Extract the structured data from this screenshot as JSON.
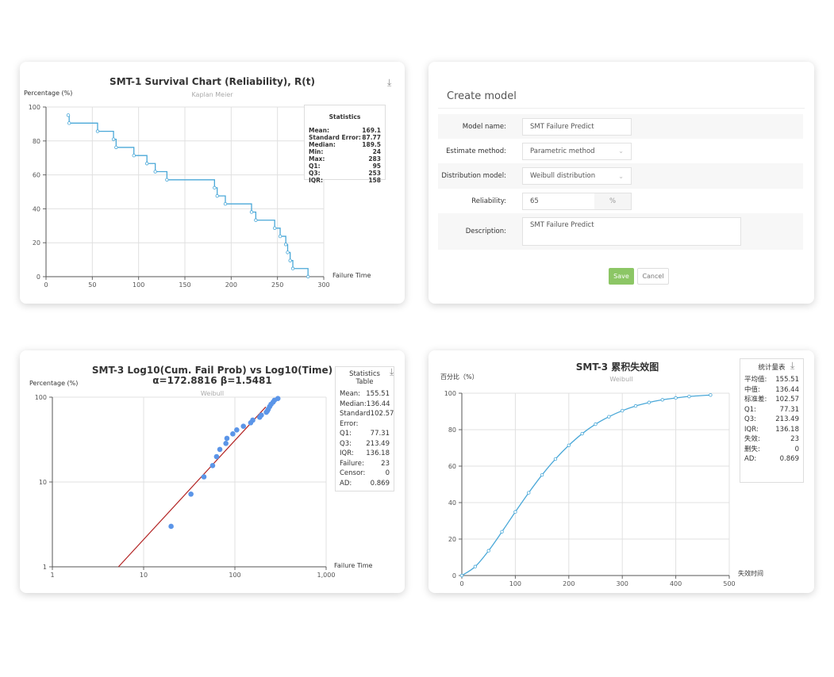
{
  "chart_data": [
    {
      "type": "line",
      "title": "SMT-1 Survival Chart (Reliability), R(t)",
      "subtitle": "Kaplan Meier",
      "ylabel": "Percentage (%)",
      "xlabel": "Failure Time",
      "step": true,
      "xlim": [
        0,
        300
      ],
      "ylim": [
        0,
        100
      ],
      "xticks": [
        "0",
        "50",
        "100",
        "150",
        "200",
        "250",
        "300"
      ],
      "yticks": [
        "0",
        "20",
        "40",
        "60",
        "80",
        "100"
      ],
      "grid": true,
      "color": "#4aa8d8",
      "x": [
        24,
        25,
        55.7,
        72.9,
        75.7,
        94.9,
        109,
        118,
        130.6,
        182,
        184.9,
        193.7,
        222,
        226.6,
        247,
        252.9,
        259,
        261,
        263.7,
        266.6,
        283
      ],
      "y": [
        95.2,
        90.5,
        85.7,
        81,
        76.2,
        71.4,
        66.7,
        61.9,
        57.1,
        52.4,
        47.6,
        42.9,
        38.1,
        33.3,
        28.6,
        23.8,
        19,
        14.3,
        9.5,
        4.8,
        0
      ],
      "stats": {
        "title": "Statistics",
        "rows": [
          [
            "Mean:",
            "169.1"
          ],
          [
            "Standard Error:",
            "87.77"
          ],
          [
            "Median:",
            "189.5"
          ],
          [
            "Min:",
            "24"
          ],
          [
            "Max:",
            "283"
          ],
          [
            "Q1:",
            "95"
          ],
          [
            "Q3:",
            "253"
          ],
          [
            "IQR:",
            "158"
          ]
        ]
      }
    },
    {
      "type": "scatter",
      "title": "SMT-3 Log10(Cum. Fail Prob) vs Log10(Time)",
      "title2": "α=172.8816 β=1.5481",
      "subtitle": "Weibull",
      "ylabel": "Percentage (%)",
      "xlabel": "Failure Time",
      "xscale": "log",
      "yscale": "log",
      "xlim": [
        1,
        1000
      ],
      "ylim": [
        1,
        100
      ],
      "xticks": [
        "1",
        "10",
        "100",
        "1,000"
      ],
      "yticks": [
        "1",
        "10",
        "100"
      ],
      "grid": true,
      "color": "#5b95e8",
      "fit_color": "#b22222",
      "x": [
        20,
        33,
        45.8,
        57,
        63,
        68.4,
        79.7,
        81.8,
        94.9,
        104.8,
        124,
        149,
        157,
        187,
        195,
        221,
        227,
        232,
        240,
        249,
        262,
        271,
        296
      ],
      "y": [
        3,
        7.2,
        11.5,
        15.6,
        19.9,
        24.2,
        28.5,
        32.7,
        36.9,
        41.1,
        45.4,
        49.9,
        53.6,
        58,
        61.4,
        66.4,
        69,
        72,
        77.3,
        82.4,
        87.3,
        91.8,
        96.4
      ],
      "fit_line": {
        "x": [
          5.3,
          218
        ],
        "y": [
          1,
          76.7
        ]
      },
      "stats": {
        "title": "Statistics Table",
        "rows": [
          [
            "Mean:",
            "155.51"
          ],
          [
            "Median:",
            "136.44"
          ],
          [
            "Standard",
            "102.57"
          ],
          [
            "Error:",
            ""
          ],
          [
            "Q1:",
            "77.31"
          ],
          [
            "Q3:",
            "213.49"
          ],
          [
            "IQR:",
            "136.18"
          ],
          [
            "Failure:",
            "23"
          ],
          [
            "Censor:",
            "0"
          ],
          [
            "AD:",
            "0.869"
          ]
        ]
      }
    },
    {
      "type": "line",
      "title": "SMT-3 累积失效图",
      "subtitle": "Weibull",
      "ylabel": "百分比（%）",
      "xlabel": "失效时间",
      "xlim": [
        0,
        500
      ],
      "ylim": [
        0,
        100
      ],
      "xticks": [
        "0",
        "100",
        "200",
        "300",
        "400",
        "500"
      ],
      "yticks": [
        "0",
        "20",
        "40",
        "60",
        "80",
        "100"
      ],
      "grid": true,
      "color": "#4aa8d8",
      "x": [
        0,
        25,
        50,
        75,
        100,
        125,
        150,
        175,
        200,
        225,
        250,
        275,
        300,
        325,
        350,
        375,
        400,
        425,
        465
      ],
      "y": [
        0,
        4.9,
        13.6,
        24.0,
        34.9,
        45.4,
        55.2,
        63.9,
        71.4,
        77.8,
        83.0,
        87.1,
        90.4,
        93.0,
        94.9,
        96.4,
        97.4,
        98.2,
        99.0
      ],
      "stats": {
        "title": "统计量表",
        "rows": [
          [
            "平均值:",
            "155.51"
          ],
          [
            "中值:",
            "136.44"
          ],
          [
            "标准差:",
            "102.57"
          ],
          [
            "Q1:",
            "77.31"
          ],
          [
            "Q3:",
            "213.49"
          ],
          [
            "IQR:",
            "136.18"
          ],
          [
            "失效:",
            "23"
          ],
          [
            "删失:",
            "0"
          ],
          [
            "AD:",
            "0.869"
          ]
        ]
      }
    }
  ],
  "form": {
    "title": "Create model",
    "fields": [
      {
        "label": "Model name:",
        "value": "SMT Failure Predict"
      },
      {
        "label": "Estimate method:",
        "value": "Parametric method"
      },
      {
        "label": "Distribution model:",
        "value": "Weibull distribution"
      },
      {
        "label": "Reliability:",
        "value": "65",
        "unit": "%"
      },
      {
        "label": "Description:",
        "value": "SMT Failure Predict"
      }
    ],
    "save_label": "Save",
    "cancel_label": "Cancel",
    "save_color": "#8cc665"
  }
}
